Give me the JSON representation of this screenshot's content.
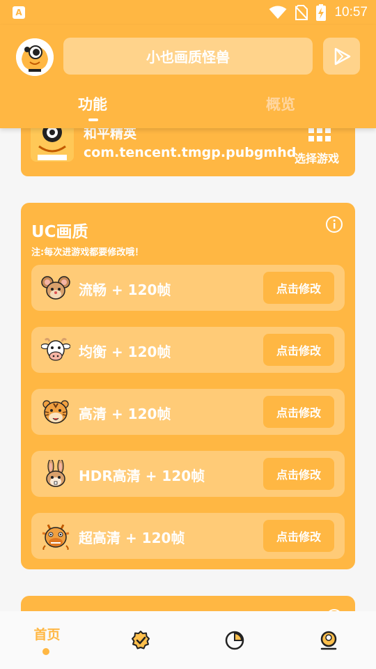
{
  "status_bar": {
    "time": "10:57",
    "app_badge": "A"
  },
  "header": {
    "title": "小也画质怪兽",
    "tabs": [
      {
        "label": "功能",
        "active": true
      },
      {
        "label": "概览",
        "active": false
      }
    ]
  },
  "game": {
    "name": "和平精英",
    "package": "com.tencent.tmgp.pubgmhd",
    "select_label": "选择游戏"
  },
  "uc": {
    "title": "UC画质",
    "note": "注:每次进游戏都要修改哦！",
    "options": [
      {
        "label": "流畅 + 120帧",
        "button": "点击修改",
        "icon": "mouse-icon"
      },
      {
        "label": "均衡 + 120帧",
        "button": "点击修改",
        "icon": "cow-icon"
      },
      {
        "label": "高清 + 120帧",
        "button": "点击修改",
        "icon": "tiger-icon"
      },
      {
        "label": "HDR高清 + 120帧",
        "button": "点击修改",
        "icon": "rabbit-icon"
      },
      {
        "label": "超高清 + 120帧",
        "button": "点击修改",
        "icon": "dragon-icon"
      }
    ]
  },
  "nav": {
    "items": [
      {
        "label": "首页",
        "icon": "home-label",
        "active": true
      },
      {
        "label": "",
        "icon": "badge-check-icon",
        "active": false
      },
      {
        "label": "",
        "icon": "pie-chart-icon",
        "active": false
      },
      {
        "label": "",
        "icon": "user-icon",
        "active": false
      }
    ]
  },
  "colors": {
    "accent": "#FFB743",
    "accent_light": "#FFCB77",
    "background": "#F6F6F6"
  }
}
